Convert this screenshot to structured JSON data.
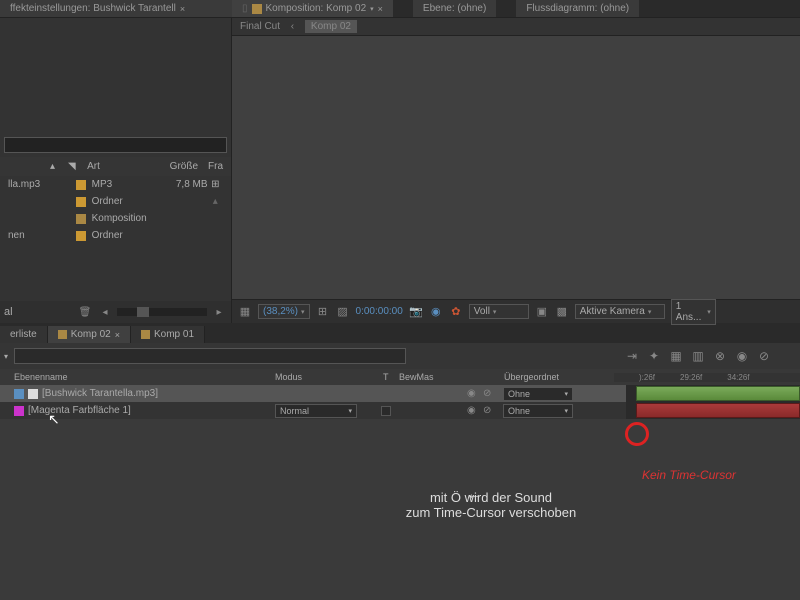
{
  "panels": {
    "effects": {
      "title": "ffekteinstellungen: Bushwick Tarantell",
      "close": "×"
    },
    "comp": {
      "title": "Komposition: Komp 02",
      "dropdown": "▾",
      "close": "×"
    },
    "layer": {
      "title": "Ebene: (ohne)"
    },
    "flow": {
      "title": "Flussdiagramm: (ohne)"
    }
  },
  "breadcrumb": {
    "root": "Final Cut",
    "arrow": "‹",
    "current": "Komp 02"
  },
  "project": {
    "header": {
      "sort": "▴",
      "tag": "◥",
      "type": "Art",
      "size": "Größe",
      "extra": "Fra"
    },
    "rows": [
      {
        "name": "lla.mp3",
        "type": "MP3",
        "size": "7,8 MB",
        "extra": "⊞"
      },
      {
        "name": "",
        "type": "Ordner",
        "size": "",
        "extra": ""
      },
      {
        "name": "",
        "type": "Komposition",
        "size": "",
        "extra": ""
      },
      {
        "name": "nen",
        "type": "Ordner",
        "size": "",
        "extra": ""
      }
    ],
    "toolbar": {
      "lbl": "al",
      "play_left": "◂",
      "play_right": "▸"
    }
  },
  "comp_toolbar": {
    "zoom": "(38,2%)",
    "timecode": "0:00:00:00",
    "quality": "Voll",
    "camera": "Aktive Kamera",
    "views": "1 Ans..."
  },
  "timeline": {
    "tabs": [
      {
        "label": "erliste",
        "active": false
      },
      {
        "label": "Komp 02",
        "active": true
      },
      {
        "label": "Komp 01",
        "active": false
      }
    ],
    "dropdown": "▾",
    "header": {
      "layer": "Ebenenname",
      "mode": "Modus",
      "t": "T",
      "trk": "BewMas",
      "parent": "Übergeordnet",
      "ticks": [
        "):26f",
        "29:26f",
        "34:26f"
      ]
    },
    "layers": [
      {
        "name": "[Bushwick Tarantella.mp3]",
        "mode": "",
        "t": false,
        "parent": "Ohne",
        "color": "audio"
      },
      {
        "name": "[Magenta Farbfläche 1]",
        "mode": "Normal",
        "t": true,
        "parent": "Ohne",
        "color": "magenta"
      }
    ]
  },
  "annotations": {
    "circle_label": "Kein Time-Cursor",
    "hint": "mit Ö wird der Sound\nzum Time-Cursor verschoben",
    "arrow": "←"
  }
}
